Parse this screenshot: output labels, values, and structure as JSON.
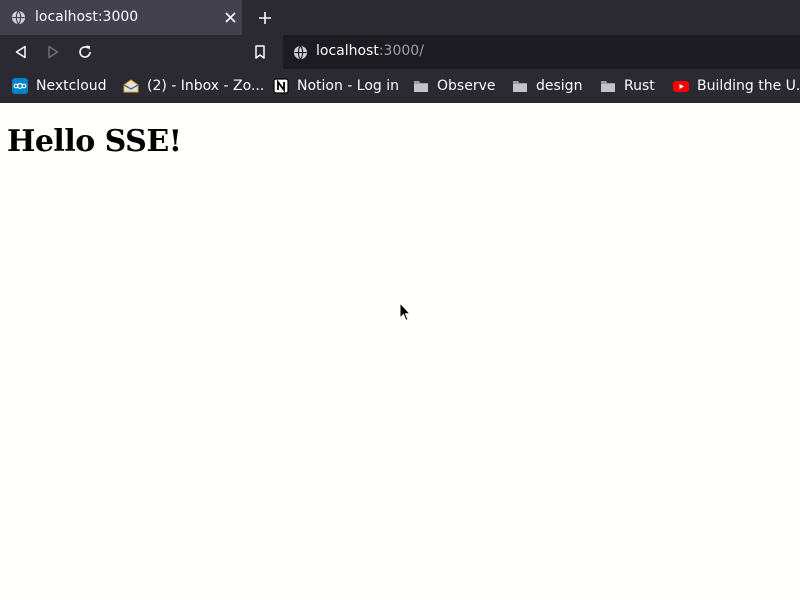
{
  "tabs": [
    {
      "title": "localhost:3000",
      "active": true
    }
  ],
  "address_bar": {
    "host": "localhost",
    "path": ":3000/"
  },
  "bookmarks": [
    {
      "label": "Nextcloud",
      "icon": "nextcloud-icon"
    },
    {
      "label": "(2) - Inbox - Zo...",
      "icon": "mail-icon"
    },
    {
      "label": "Notion - Log in",
      "icon": "notion-icon"
    },
    {
      "label": "Observe",
      "icon": "folder-icon"
    },
    {
      "label": "design",
      "icon": "folder-icon"
    },
    {
      "label": "Rust",
      "icon": "folder-icon"
    },
    {
      "label": "Building the U...",
      "icon": "youtube-icon"
    }
  ],
  "page": {
    "heading": "Hello SSE!"
  },
  "colors": {
    "toolbar": "#2b2a33",
    "active_tab": "#42414d",
    "urlbar": "#1c1b22",
    "page_background": "#fffffb"
  }
}
